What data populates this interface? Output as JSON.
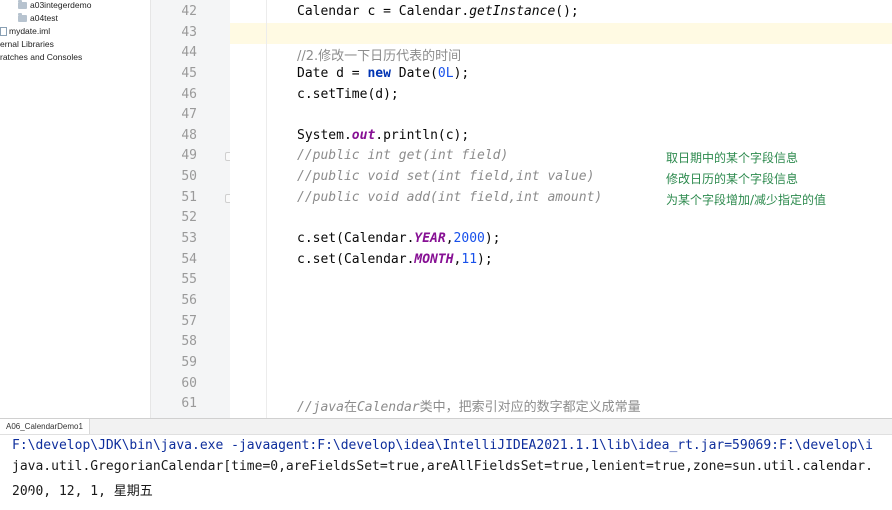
{
  "project_tree": [
    {
      "label": "a03integerdemo",
      "icon": "folder-icon"
    },
    {
      "label": "a04test",
      "icon": "folder-icon"
    },
    {
      "label": "mydate.iml",
      "icon": "file-icon"
    },
    {
      "label": "ernal Libraries",
      "icon": ""
    },
    {
      "label": "ratches and Consoles",
      "icon": ""
    }
  ],
  "line_numbers": [
    "42",
    "43",
    "44",
    "45",
    "46",
    "47",
    "48",
    "49",
    "50",
    "51",
    "52",
    "53",
    "54",
    "55",
    "56",
    "57",
    "58",
    "59",
    "60",
    "61"
  ],
  "code": {
    "l42": {
      "a": "Calendar c = Calendar.",
      "b": "getInstance",
      "c": "();"
    },
    "l44": "//2.修改一下日历代表的时间",
    "l45": {
      "a": "Date d = ",
      "kw": "new",
      "b": " Date(",
      "num": "0L",
      "c": ");"
    },
    "l46": "c.setTime(d);",
    "l48": {
      "a": "System.",
      "fld": "out",
      "b": ".println(c);"
    },
    "l49": "//public int get(int field)",
    "l50": "//public void set(int field,int value)",
    "l51": "//public void add(int field,int amount)",
    "l53": {
      "a": "c.set(Calendar.",
      "fld": "YEAR",
      "b": ",",
      "num": "2000",
      "c": ");"
    },
    "l54": {
      "a": "c.set(Calendar.",
      "fld": "MONTH",
      "b": ",",
      "num": "11",
      "c": ");"
    },
    "l61": {
      "a": "//java",
      "cn1": "在",
      "b": "Calendar",
      "cn2": "类中，把索引对应的数字都定义成常量"
    }
  },
  "annotations": [
    "取日期中的某个字段信息",
    "修改日历的某个字段信息",
    "为某个字段增加/减少指定的值"
  ],
  "run_panel": {
    "tab_label": "A06_CalendarDemo1",
    "console_lines": [
      "F:\\develop\\JDK\\bin\\java.exe -javaagent:F:\\develop\\idea\\IntelliJIDEA2021.1.1\\lib\\idea_rt.jar=59069:F:\\develop\\i",
      "java.util.GregorianCalendar[time=0,areFieldsSet=true,areAllFieldsSet=true,lenient=true,zone=sun.util.calendar.",
      "2000, 12, 1, 星期五"
    ]
  },
  "colors": {
    "keyword": "#0033b3",
    "number": "#1750eb",
    "field": "#871094",
    "comment": "#8c8c8c",
    "annotation": "#2d8a4e",
    "current_line": "#fffae3"
  }
}
